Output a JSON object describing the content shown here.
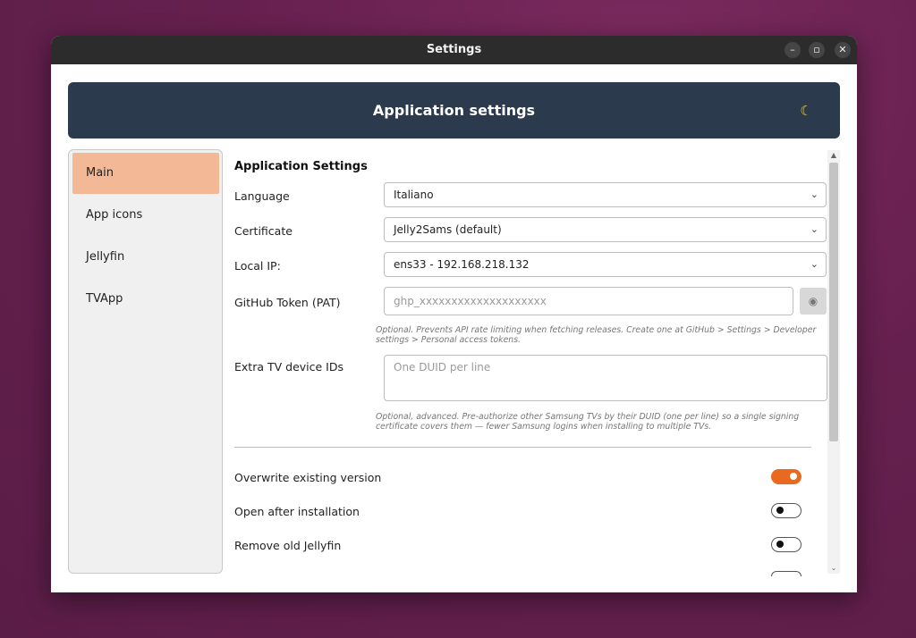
{
  "window": {
    "title": "Settings"
  },
  "banner": {
    "title": "Application settings",
    "theme_icon": "moon-icon"
  },
  "sidebar": {
    "items": [
      {
        "label": "Main",
        "active": true
      },
      {
        "label": "App icons",
        "active": false
      },
      {
        "label": "Jellyfin",
        "active": false
      },
      {
        "label": "TVApp",
        "active": false
      }
    ]
  },
  "main": {
    "section_title": "Application Settings",
    "language": {
      "label": "Language",
      "value": "Italiano"
    },
    "certificate": {
      "label": "Certificate",
      "value": "Jelly2Sams (default)"
    },
    "local_ip": {
      "label": "Local IP:",
      "value": "ens33 - 192.168.218.132"
    },
    "github_token": {
      "label": "GitHub Token (PAT)",
      "placeholder": "ghp_xxxxxxxxxxxxxxxxxxxx",
      "help": "Optional. Prevents API rate limiting when fetching releases. Create one at GitHub > Settings > Developer settings > Personal access tokens."
    },
    "extra_tv_ids": {
      "label": "Extra TV device IDs",
      "placeholder": "One DUID per line",
      "help": "Optional, advanced. Pre-authorize other Samsung TVs by their DUID (one per line) so a single signing certificate covers them — fewer Samsung logins when installing to multiple TVs."
    },
    "toggles": [
      {
        "label": "Overwrite existing version",
        "on": true
      },
      {
        "label": "Open after installation",
        "on": false
      },
      {
        "label": "Remove old Jellyfin",
        "on": false
      }
    ]
  },
  "colors": {
    "accent": "#e96a1f",
    "banner": "#2b3a4c",
    "sidebar_active": "#f3b896"
  }
}
